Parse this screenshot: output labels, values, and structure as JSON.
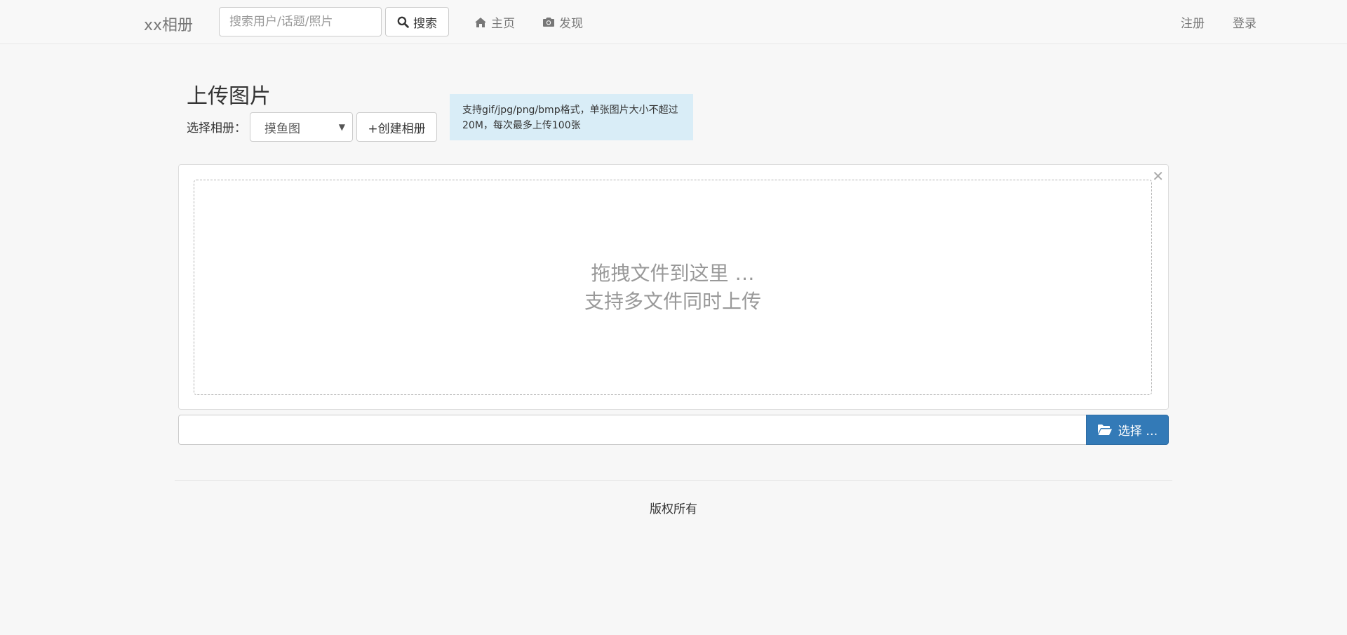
{
  "navbar": {
    "brand": "xx相册",
    "search_placeholder": "搜索用户/话题/照片",
    "search_button": "搜索",
    "nav_home": "主页",
    "nav_discover": "发现",
    "register": "注册",
    "login": "登录"
  },
  "upload": {
    "title": "上传图片",
    "album_label": "选择相册：",
    "album_selected": "摸鱼图",
    "create_album": "+创建相册",
    "info_line1": "支持gif/jpg/png/bmp格式，单张图片大小不超过",
    "info_line2": "20M，每次最多上传100张",
    "drop_line1": "拖拽文件到这里 …",
    "drop_line2": "支持多文件同时上传",
    "browse_button": "选择 …"
  },
  "footer": {
    "text": "版权所有"
  },
  "colors": {
    "primary": "#337ab7",
    "info_bg": "#d9edf7",
    "page_bg": "#f7f7f7"
  },
  "icons": {
    "search": "search-icon",
    "home": "home-icon",
    "camera": "camera-icon",
    "close": "close-icon",
    "folder": "folder-open-icon"
  }
}
